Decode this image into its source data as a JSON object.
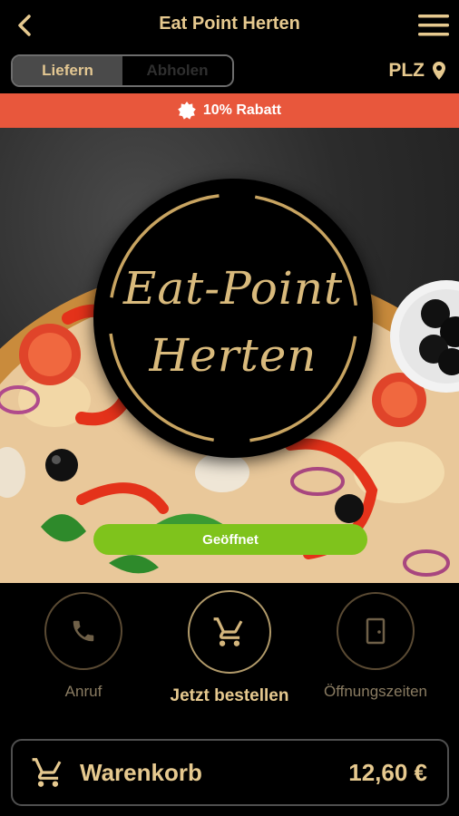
{
  "header": {
    "title": "Eat Point Herten",
    "back_icon": "chevron-left-icon",
    "menu_icon": "hamburger-menu-icon"
  },
  "delivery_toggle": {
    "options": [
      "Liefern",
      "Abholen"
    ],
    "selected": "Liefern"
  },
  "postcode": {
    "label": "PLZ",
    "icon": "location-pin-icon"
  },
  "discount_banner": {
    "text": "10% Rabatt",
    "icon": "badge-icon",
    "color": "#e8573c"
  },
  "hero": {
    "logo_line1": "Eat-Point",
    "logo_line2": "Herten",
    "status": "Geöffnet",
    "status_color": "#7fc31c"
  },
  "actions": [
    {
      "label": "Anruf",
      "icon": "phone-icon"
    },
    {
      "label": "Jetzt bestellen",
      "icon": "cart-icon"
    },
    {
      "label": "Öffnungszeiten",
      "icon": "door-icon"
    }
  ],
  "cart": {
    "label": "Warenkorb",
    "total": "12,60 €",
    "icon": "cart-icon"
  },
  "colors": {
    "accent_gold": "#e6c98f",
    "background": "#000000"
  }
}
